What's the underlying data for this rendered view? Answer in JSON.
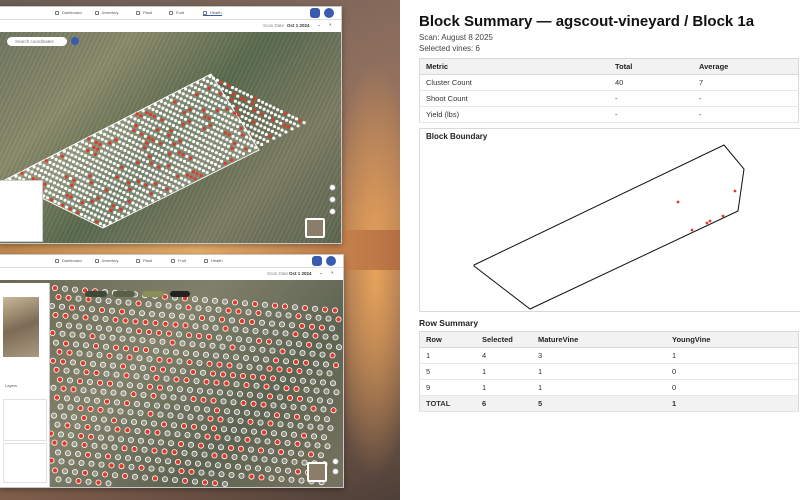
{
  "summary": {
    "title": "Block Summary — agscout-vineyard / Block 1a",
    "scan": "Scan: August 8 2025",
    "selected": "Selected vines: 6"
  },
  "metrics": {
    "headers": [
      "Metric",
      "Total",
      "Average"
    ],
    "rows": [
      [
        "Cluster Count",
        "40",
        "7"
      ],
      [
        "Shoot Count",
        "-",
        "-"
      ],
      [
        "Yield (lbs)",
        "-",
        "-"
      ]
    ]
  },
  "boundary": {
    "title": "Block Boundary"
  },
  "rows_section": {
    "title": "Row Summary",
    "headers": [
      "Row",
      "Selected",
      "MatureVine",
      "YoungVine"
    ],
    "rows": [
      [
        "1",
        "4",
        "3",
        "1"
      ],
      [
        "5",
        "1",
        "1",
        "0"
      ],
      [
        "9",
        "1",
        "1",
        "0"
      ]
    ],
    "total": [
      "TOTAL",
      "6",
      "5",
      "1"
    ]
  },
  "bg_app": {
    "nav": [
      "Dashboard",
      "Inventory",
      "Plant",
      "Fruit",
      "Health"
    ],
    "scan_label": "Scan Date",
    "date_top": "Oct 1 2024",
    "date_bottom": "Oct 1 2024",
    "search_placeholder": "Search coordinates",
    "layers_label": "Layers",
    "accent": "#3b5bb0",
    "dot_red": "#e0392b"
  }
}
